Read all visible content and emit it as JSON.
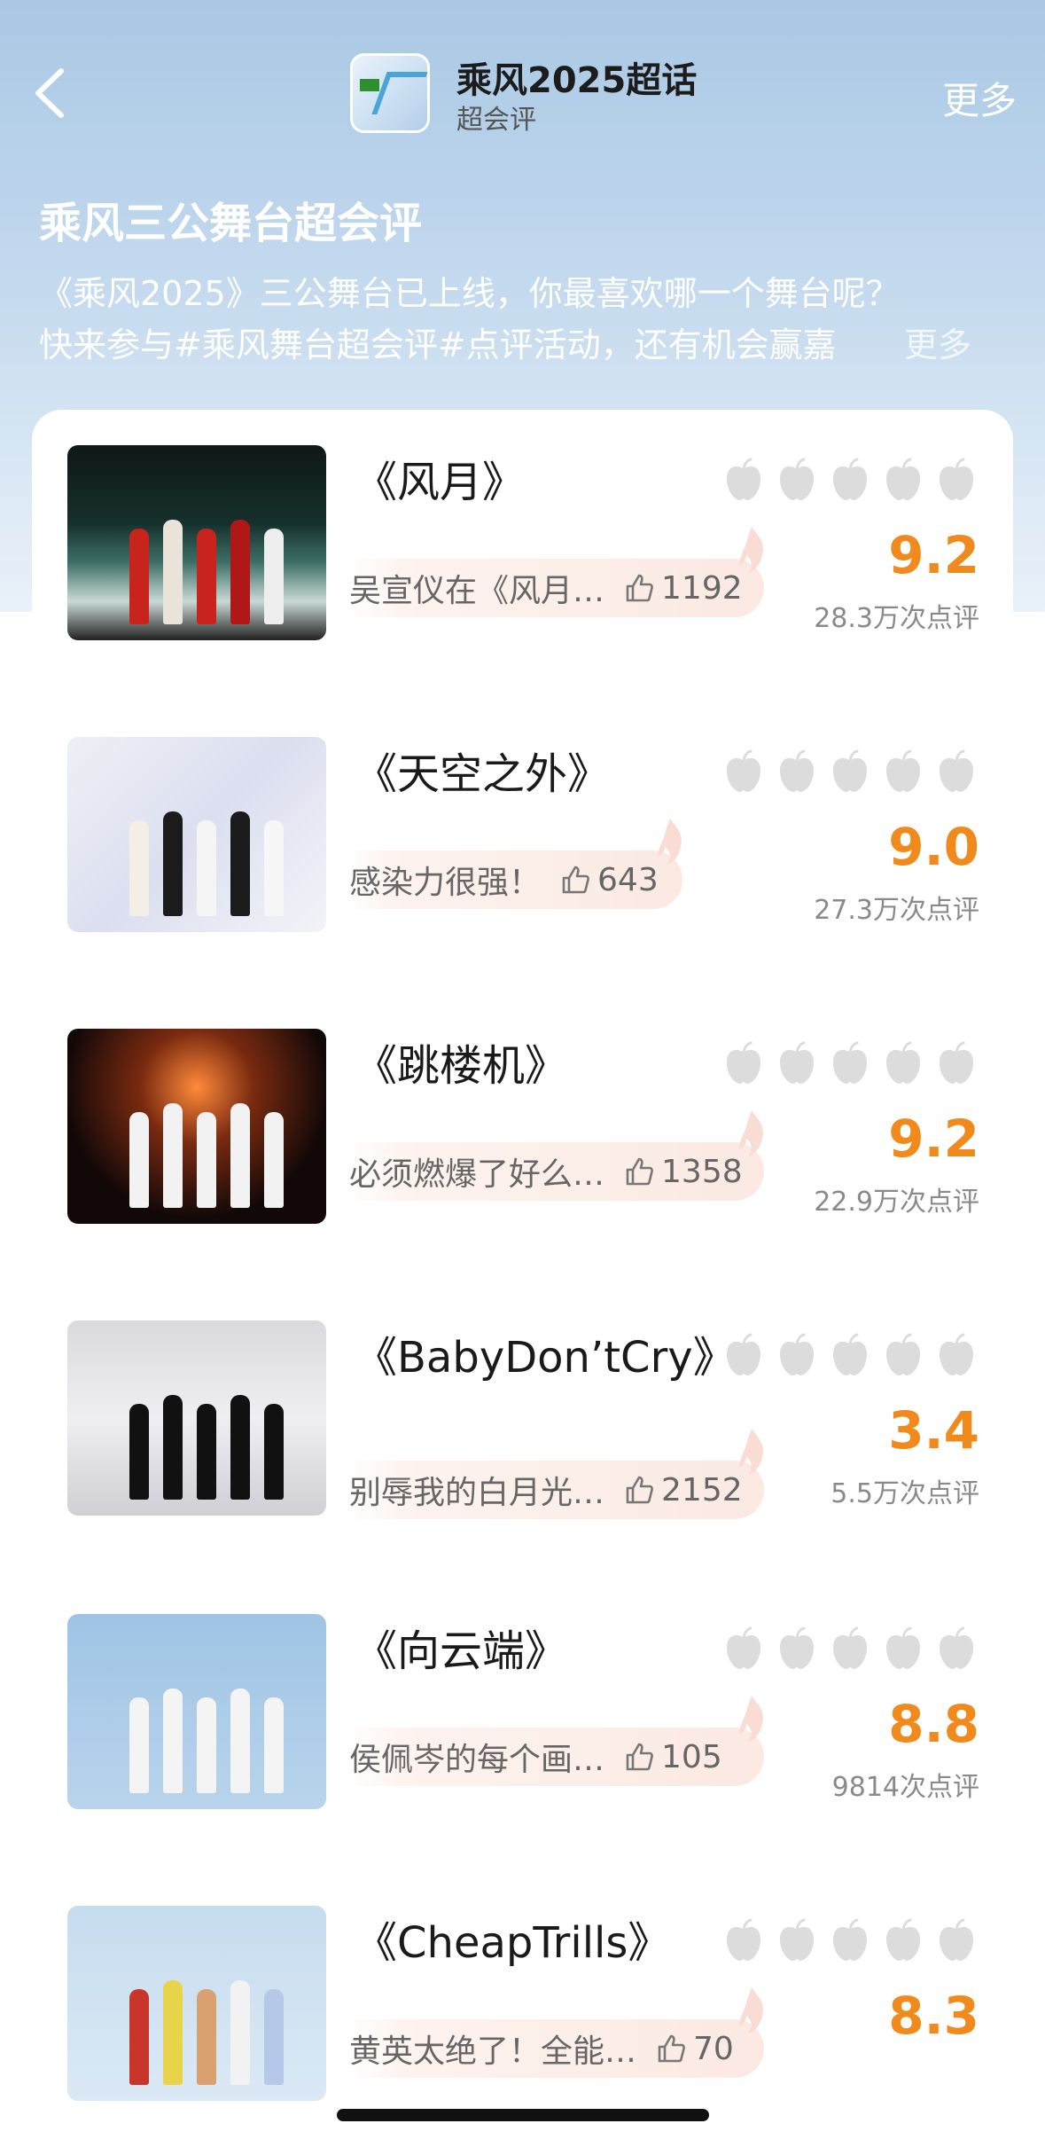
{
  "header": {
    "topic_title": "乘风2025超话",
    "topic_subtitle": "超会评",
    "more_label": "更多"
  },
  "page": {
    "title": "乘风三公舞台超会评",
    "description_line1": "《乘风2025》三公舞台已上线，你最喜欢哪一个舞台呢？",
    "description_line2": "快来参与#乘风舞台超会评#点评活动，还有机会赢嘉",
    "description_more": "更多"
  },
  "stages": [
    {
      "title": "《风月》",
      "comment": "吴宣仪在《风月…",
      "likes": "1192",
      "score": "9.2",
      "reviews": "28.3万次点评"
    },
    {
      "title": "《天空之外》",
      "comment": "感染力很强！",
      "likes": "643",
      "score": "9.0",
      "reviews": "27.3万次点评"
    },
    {
      "title": "《跳楼机》",
      "comment": "必须燃爆了好么…",
      "likes": "1358",
      "score": "9.2",
      "reviews": "22.9万次点评"
    },
    {
      "title": "《BabyDon’tCry》",
      "comment": "别辱我的白月光…",
      "likes": "2152",
      "score": "3.4",
      "reviews": "5.5万次点评"
    },
    {
      "title": "《向云端》",
      "comment": "侯佩岑的每个画…",
      "likes": "105",
      "score": "8.8",
      "reviews": "9814次点评"
    },
    {
      "title": "《CheapTrills》",
      "comment": "黄英太绝了！全能…",
      "likes": "70",
      "score": "8.3",
      "reviews": ""
    }
  ],
  "icons": {
    "back": "chevron-left-icon",
    "like": "thumbs-up-icon",
    "rating": "apple-icon"
  },
  "colors": {
    "score": "#f08a1c",
    "hero_top": "#a9c8e4",
    "apple": "#dcdcdc"
  }
}
